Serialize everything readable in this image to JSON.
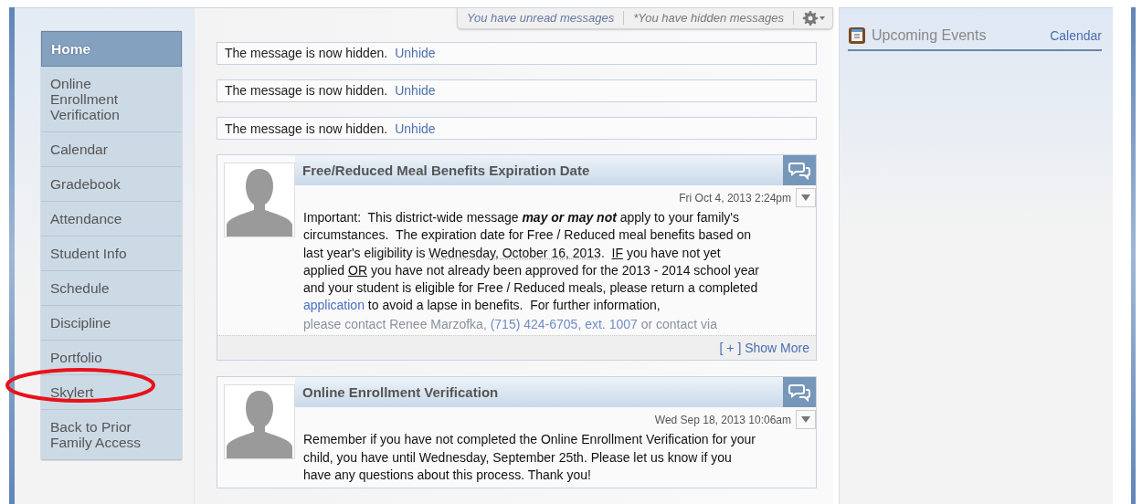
{
  "sidebar": {
    "items": [
      {
        "label": "Home",
        "selected": true
      },
      {
        "label": "Online Enrollment Verification",
        "selected": false
      },
      {
        "label": "Calendar",
        "selected": false
      },
      {
        "label": "Gradebook",
        "selected": false
      },
      {
        "label": "Attendance",
        "selected": false
      },
      {
        "label": "Student Info",
        "selected": false
      },
      {
        "label": "Schedule",
        "selected": false
      },
      {
        "label": "Discipline",
        "selected": false
      },
      {
        "label": "Portfolio",
        "selected": false
      },
      {
        "label": "Skylert",
        "selected": false
      },
      {
        "label": "Back to Prior Family Access",
        "selected": false
      }
    ]
  },
  "toolbar": {
    "links": [
      "You have unread messages",
      "*You have hidden messages"
    ]
  },
  "hidden_messages": [
    {
      "text": "The message is now hidden.",
      "action": "Unhide"
    },
    {
      "text": "The message is now hidden.",
      "action": "Unhide"
    },
    {
      "text": "The message is now hidden.",
      "action": "Unhide"
    }
  ],
  "messages": [
    {
      "title": "Free/Reduced Meal Benefits Expiration Date",
      "date": "Fri Oct 4, 2013 2:24pm",
      "body": [
        {
          "kind": "text",
          "text": "Important:  This district-wide message "
        },
        {
          "kind": "strong",
          "text": "may or may not"
        },
        {
          "kind": "text",
          "text": " apply to your family's circumstances.  The expiration date for Free / Reduced meal benefits based on last year's eligibility is "
        },
        {
          "kind": "dotted",
          "text": "Wednesday, October 16, 2013"
        },
        {
          "kind": "text",
          "text": ".  "
        },
        {
          "kind": "underline",
          "text": "IF"
        },
        {
          "kind": "text",
          "text": " you have not yet applied "
        },
        {
          "kind": "underline",
          "text": "OR"
        },
        {
          "kind": "text",
          "text": " you have not already been approved for the 2013 - 2014 school year and your student is eligible for Free / Reduced meals, please return a completed "
        },
        {
          "kind": "link",
          "text": "application"
        },
        {
          "kind": "text",
          "text": " to avoid a lapse in benefits.  For further information,"
        }
      ],
      "faded": [
        {
          "kind": "text",
          "text": "please contact Renee Marzofka, "
        },
        {
          "kind": "link",
          "text": "(715) 424-6705, ext. 1007"
        },
        {
          "kind": "text",
          "text": " or contact via"
        }
      ],
      "more": "[ + ] Show More"
    },
    {
      "title": "Online Enrollment Verification",
      "date": "Wed Sep 18, 2013 10:06am",
      "body": [
        {
          "kind": "text",
          "text": "Remember if you have not completed the Online Enrollment Verification for your child, you have until Wednesday, September 25th. Please let us know if you have any questions about this process. Thank you!"
        }
      ]
    }
  ],
  "events": {
    "title": "Upcoming Events",
    "link": "Calendar"
  }
}
